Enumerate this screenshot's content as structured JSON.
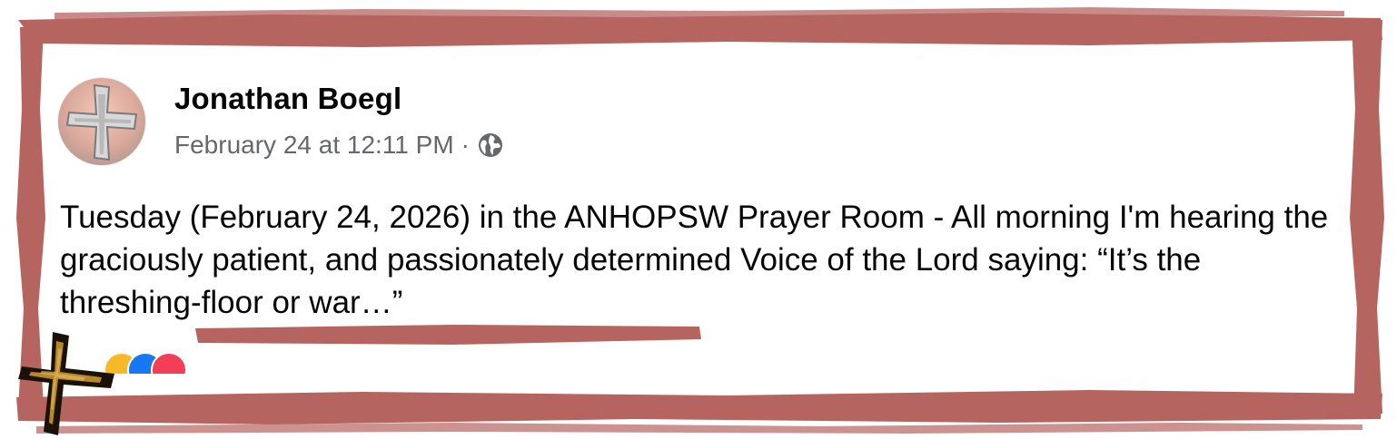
{
  "post": {
    "author": "Jonathan Boegl",
    "timestamp": "February 24 at 12:11 PM",
    "separator": "·",
    "privacy_icon": "globe-icon",
    "text": "Tuesday (February 24, 2026) in the ANHOPSW Prayer Room - All morning I'm hearing the graciously patient, and passionately determined Voice of the Lord saying: “It’s the threshing-floor or war…”",
    "reactions": [
      "haha",
      "like",
      "love"
    ]
  },
  "decorations": {
    "frame": "brush-stroke-frame",
    "logo": "cross-logo"
  },
  "colors": {
    "frame": "#b5645f",
    "name": "#050505",
    "meta": "#65676b",
    "like": "#1877f2",
    "love": "#f33e58",
    "haha": "#f7b928"
  }
}
